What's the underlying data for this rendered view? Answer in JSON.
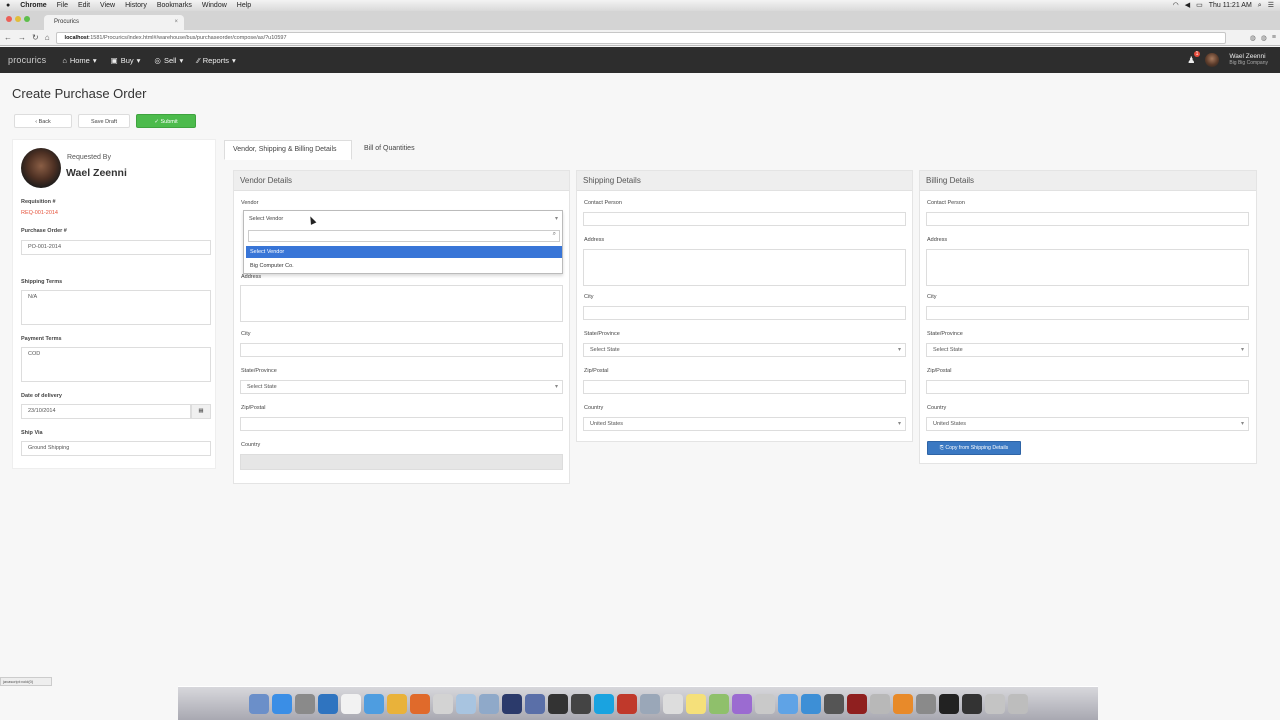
{
  "macmenu": {
    "apple": "",
    "app": "Chrome",
    "items": [
      "File",
      "Edit",
      "View",
      "History",
      "Bookmarks",
      "Window",
      "Help"
    ],
    "clock": "Thu 11:21 AM"
  },
  "browser": {
    "tab_title": "Procurics",
    "url_host": "localhost",
    "url_path": ":1581/Procurics/index.html#/warehouse/bus/purchaseorder/compose/as/?u10597"
  },
  "nav": {
    "brand": "procurics",
    "items": [
      "Home",
      "Buy",
      "Sell",
      "Reports"
    ],
    "user_name": "Wael Zeenni",
    "user_sub": "Big Big Company",
    "notif_count": "1"
  },
  "page": {
    "title": "Create Purchase Order"
  },
  "actions": {
    "back": "‹ Back",
    "save_draft": "Save Draft",
    "submit": "✓ Submit"
  },
  "requester": {
    "label": "Requested By",
    "name": "Wael Zeenni"
  },
  "left": {
    "requisition_label": "Requisition #",
    "requisition_value": "REQ-001-2014",
    "po_label": "Purchase Order #",
    "po_value": "PO-001-2014",
    "shipping_terms_label": "Shipping Terms",
    "shipping_terms_value": "N/A",
    "payment_terms_label": "Payment Terms",
    "payment_terms_value": "COD",
    "delivery_label": "Date of delivery",
    "delivery_value": "23/10/2014",
    "shipvia_label": "Ship Via",
    "shipvia_value": "Ground Shipping"
  },
  "tabs": [
    "Vendor, Shipping & Billing Details",
    "Bill of Quantities"
  ],
  "vendor": {
    "header": "Vendor Details",
    "vendor_label": "Vendor",
    "vendor_value": "Select Vendor",
    "options": [
      "Select Vendor",
      "Big Computer Co."
    ],
    "address_label": "Address",
    "city_label": "City",
    "state_label": "State/Province",
    "state_value": "Select State",
    "zip_label": "Zip/Postal",
    "country_label": "Country"
  },
  "shipping": {
    "header": "Shipping Details",
    "contact_label": "Contact Person",
    "address_label": "Address",
    "city_label": "City",
    "state_label": "State/Province",
    "state_value": "Select State",
    "zip_label": "Zip/Postal",
    "country_label": "Country",
    "country_value": "United States"
  },
  "billing": {
    "header": "Billing Details",
    "contact_label": "Contact Person",
    "address_label": "Address",
    "city_label": "City",
    "state_label": "State/Province",
    "state_value": "Select State",
    "zip_label": "Zip/Postal",
    "country_label": "Country",
    "country_value": "United States",
    "copy_button": "Copy from Shipping Details"
  },
  "status_text": "javascript:void(0)"
}
